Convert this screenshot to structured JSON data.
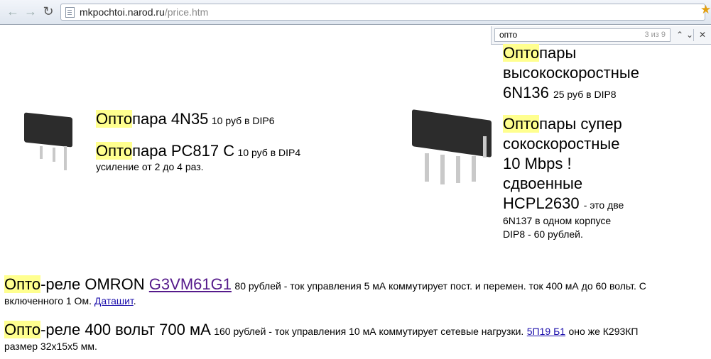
{
  "browser": {
    "url_host": "mkpochtoi.narod.ru",
    "url_path": "/price.htm",
    "find": {
      "query": "опто",
      "count": "3 из 9"
    }
  },
  "items": {
    "o1": {
      "hl": "Опто",
      "rest": "пара  4N35",
      "price": "10 руб в DIP6"
    },
    "o2": {
      "hl": "Опто",
      "rest": "пара  PC817 C",
      "price": "10 руб в DIP4",
      "note": "усиление от 2 до 4 раз."
    },
    "o3": {
      "hl": "Опто",
      "l1": "пары",
      "l2": "высокоскоростные",
      "l3": "6N136",
      "price": "25 руб в DIP8"
    },
    "o4": {
      "hl": "Опто",
      "l1": "пары супер",
      "l2": "сокоскоростные",
      "l3": "10 Mbps !",
      "l4": "сдвоенные",
      "l5": "HCPL2630",
      "price": "- это две",
      "n1": "6N137 в одном корпусе",
      "n2": "DIP8  - 60 рублей."
    },
    "r1": {
      "hl": "Опто",
      "rest": "-реле OMRON",
      "link": "G3VM61G1",
      "price": "80 рублей - ток управления 5 мА коммутирует пост. и перемен. ток 400 мА до 60 вольт. С",
      "l2": "включенного 1 Ом.",
      "link2": "Даташит"
    },
    "r2": {
      "hl": "Опто",
      "rest": "-реле 400 вольт 700 мА",
      "price": "160 рублей - ток управления 10 мА коммутирует сетевые нагрузки.",
      "link": "5П19 Б1",
      "tail": "оно же К293КП",
      "l2": "размер  32x15x5 мм."
    }
  },
  "colors": {
    "highlight": "#ffff8f",
    "link": "#1a0dab",
    "visited": "#551a8b"
  }
}
